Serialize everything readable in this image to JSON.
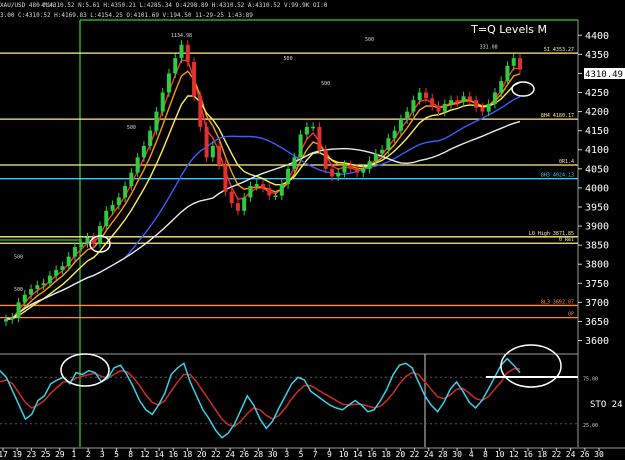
{
  "header": {
    "symbol": "XAU/USD 480-Min",
    "ohlc": "C:4310.52 N:5.61 H:4350.21 L:4285.34 O:4298.89 H:4310.52 A:4310.52 V:99.9K OI:0",
    "line2": "3.00 C:4310.52 H:4169.83 L:4154.25 O:4101.69 V:194.50 11-29-25 1:43:89"
  },
  "levels_title": "T=Q Levels M",
  "last_price": "4310.49",
  "colors": {
    "bull": "#2ecc40",
    "bear": "#e03030",
    "ma_red": "#ff3030",
    "ma_orange": "#ff9900",
    "ma_yellow": "#ffee55",
    "ma_blue": "#3a5cff",
    "ma_white": "#e8e8e8",
    "sto_fast": "#3ad0e8",
    "sto_slow": "#d02a2a",
    "level_cyan": "#33ccff",
    "level_yellow": "#ffee88",
    "level_orange": "#ff8a2a",
    "green_line": "#39ff39"
  },
  "chart_data": {
    "type": "line",
    "y_axis": {
      "ylim": [
        3570,
        4440
      ],
      "ticks": [
        3600,
        3650,
        3700,
        3750,
        3800,
        3850,
        3900,
        3950,
        4000,
        4050,
        4100,
        4150,
        4200,
        4250,
        4300,
        4350,
        4400
      ]
    },
    "x_tick_labels": [
      "17",
      "19",
      "23",
      "25",
      "29",
      "1",
      "2",
      "3",
      "5",
      "8",
      "12",
      "14",
      "16",
      "18",
      "20",
      "22",
      "24",
      "26",
      "28",
      "30",
      "3",
      "5",
      "7",
      "9",
      "10",
      "14",
      "16",
      "18",
      "20",
      "22",
      "24",
      "28",
      "30",
      "4",
      "8",
      "10",
      "12",
      "16",
      "18",
      "22",
      "24",
      "26",
      "30"
    ],
    "price_series": [
      3656,
      3660,
      3700,
      3720,
      3735,
      3745,
      3750,
      3770,
      3785,
      3795,
      3820,
      3845,
      3855,
      3870,
      3855,
      3900,
      3940,
      3955,
      3975,
      4005,
      4040,
      4080,
      4110,
      4150,
      4200,
      4250,
      4300,
      4340,
      4375,
      4330,
      4240,
      4160,
      4080,
      4110,
      4060,
      3990,
      3960,
      3940,
      3975,
      4005,
      4010,
      4000,
      3980,
      3980,
      4010,
      4050,
      4080,
      4140,
      4160,
      4160,
      4100,
      4050,
      4030,
      4040,
      4060,
      4050,
      4040,
      4050,
      4070,
      4090,
      4100,
      4130,
      4150,
      4180,
      4200,
      4230,
      4250,
      4235,
      4215,
      4200,
      4220,
      4230,
      4225,
      4240,
      4230,
      4210,
      4200,
      4220,
      4250,
      4280,
      4320,
      4340,
      4310
    ],
    "level_lines": [
      {
        "label": "8H4 4180.17",
        "value": 4180.17,
        "color": "#ffee88"
      },
      {
        "label": "8H3 4024.13",
        "value": 4024.13,
        "color": "#33ccff"
      },
      {
        "label": "L0 High 3871.85",
        "value": 3871.85,
        "color": "#ffee88"
      },
      {
        "label": "8L3 3692.07",
        "value": 3692.07,
        "color": "#ff8a2a"
      },
      {
        "label": "5I 4353.27",
        "value": 4353.27,
        "color": "#ffee88"
      },
      {
        "label": "0R1.4",
        "value": 4060,
        "color": "#ffee88"
      },
      {
        "label": "0 Rel",
        "value": 3855,
        "color": "#ffee88"
      },
      {
        "label": "0P",
        "value": 3660,
        "color": "#ff8a2a"
      }
    ],
    "annotations": [
      {
        "text": "1134.98",
        "x_index": 28,
        "y": 4395
      },
      {
        "text": "331.08",
        "x_index": 77,
        "y": 4365
      },
      {
        "text": "500",
        "x_index": 58,
        "y": 4385
      },
      {
        "text": "500",
        "x_index": 45,
        "y": 4335
      },
      {
        "text": "500",
        "x_index": 20,
        "y": 4155
      },
      {
        "text": "500",
        "x_index": 2,
        "y": 3815
      },
      {
        "text": "500",
        "x_index": 2,
        "y": 3730
      },
      {
        "text": "500",
        "x_index": 51,
        "y": 4270
      }
    ],
    "stochastic": {
      "label": "STO 24",
      "ylim": [
        0,
        100
      ],
      "ticks": [
        25,
        75
      ],
      "fast": [
        82,
        75,
        60,
        45,
        30,
        35,
        50,
        55,
        68,
        72,
        75,
        68,
        80,
        78,
        82,
        80,
        70,
        74,
        85,
        88,
        78,
        65,
        50,
        40,
        35,
        45,
        58,
        78,
        85,
        90,
        70,
        55,
        40,
        30,
        18,
        10,
        15,
        25,
        40,
        55,
        45,
        30,
        20,
        28,
        42,
        55,
        68,
        75,
        72,
        60,
        55,
        50,
        45,
        42,
        40,
        45,
        50,
        45,
        38,
        40,
        50,
        62,
        78,
        88,
        90,
        85,
        70,
        55,
        45,
        38,
        48,
        62,
        70,
        60,
        48,
        42,
        50,
        62,
        75,
        88,
        95,
        88,
        80
      ],
      "slow": [
        70,
        72,
        68,
        58,
        48,
        42,
        45,
        50,
        58,
        64,
        70,
        70,
        74,
        76,
        78,
        79,
        76,
        74,
        78,
        82,
        81,
        75,
        66,
        56,
        48,
        45,
        50,
        60,
        70,
        78,
        78,
        70,
        60,
        50,
        40,
        30,
        24,
        22,
        28,
        36,
        42,
        40,
        34,
        30,
        34,
        42,
        52,
        60,
        66,
        66,
        62,
        58,
        54,
        50,
        46,
        45,
        46,
        46,
        44,
        42,
        44,
        50,
        58,
        68,
        76,
        80,
        78,
        70,
        62,
        54,
        52,
        56,
        62,
        63,
        58,
        52,
        50,
        54,
        62,
        70,
        80,
        84,
        84
      ]
    }
  }
}
